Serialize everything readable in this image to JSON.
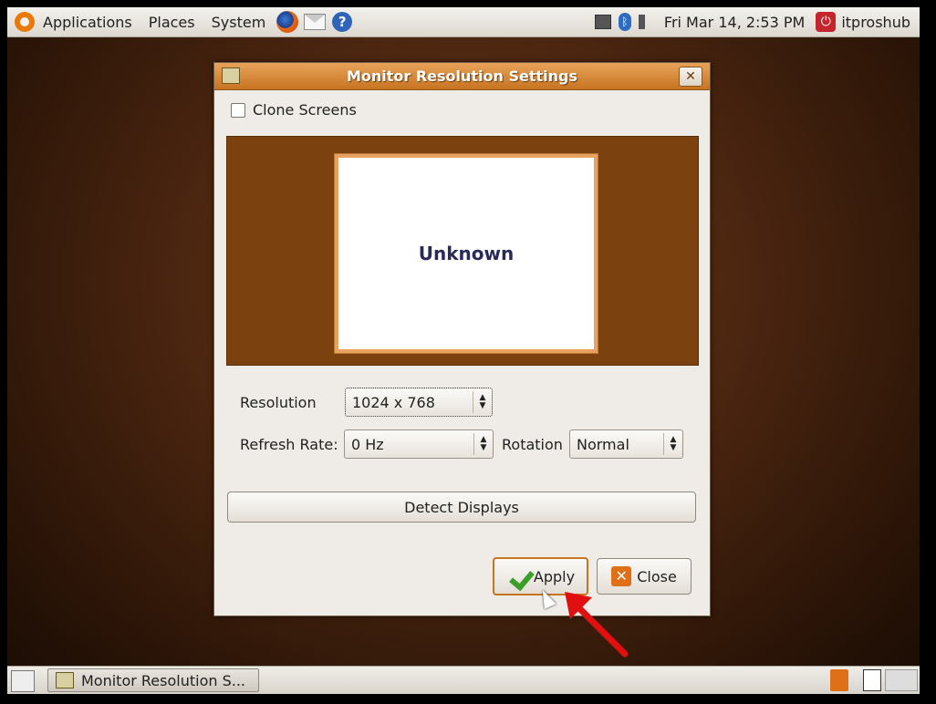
{
  "top_panel": {
    "menus": [
      "Applications",
      "Places",
      "System"
    ],
    "clock": "Fri Mar 14,  2:53 PM",
    "user": "itproshub",
    "help_glyph": "?"
  },
  "dialog": {
    "title": "Monitor Resolution Settings",
    "close_glyph": "✕",
    "clone_label": "Clone Screens",
    "clone_checked": false,
    "monitor_label": "Unknown",
    "resolution_label": "Resolution",
    "resolution_value": "1024 x 768",
    "refresh_label": "Refresh Rate:",
    "refresh_value": "0 Hz",
    "rotation_label": "Rotation",
    "rotation_value": "Normal",
    "detect_label": "Detect Displays",
    "apply_label": "Apply",
    "close_label": "Close"
  },
  "bottom_panel": {
    "task_label": "Monitor Resolution S..."
  },
  "colors": {
    "title_bar": "#c77420",
    "monitor_bg": "#7b410f",
    "annotation_arrow": "#e01010"
  },
  "icons": [
    "ubuntu-logo-icon",
    "firefox-icon",
    "mail-icon",
    "help-icon",
    "network-icon",
    "bluetooth-icon",
    "volume-icon",
    "power-icon",
    "check-icon",
    "close-icon",
    "trash-icon",
    "show-desktop-icon"
  ]
}
